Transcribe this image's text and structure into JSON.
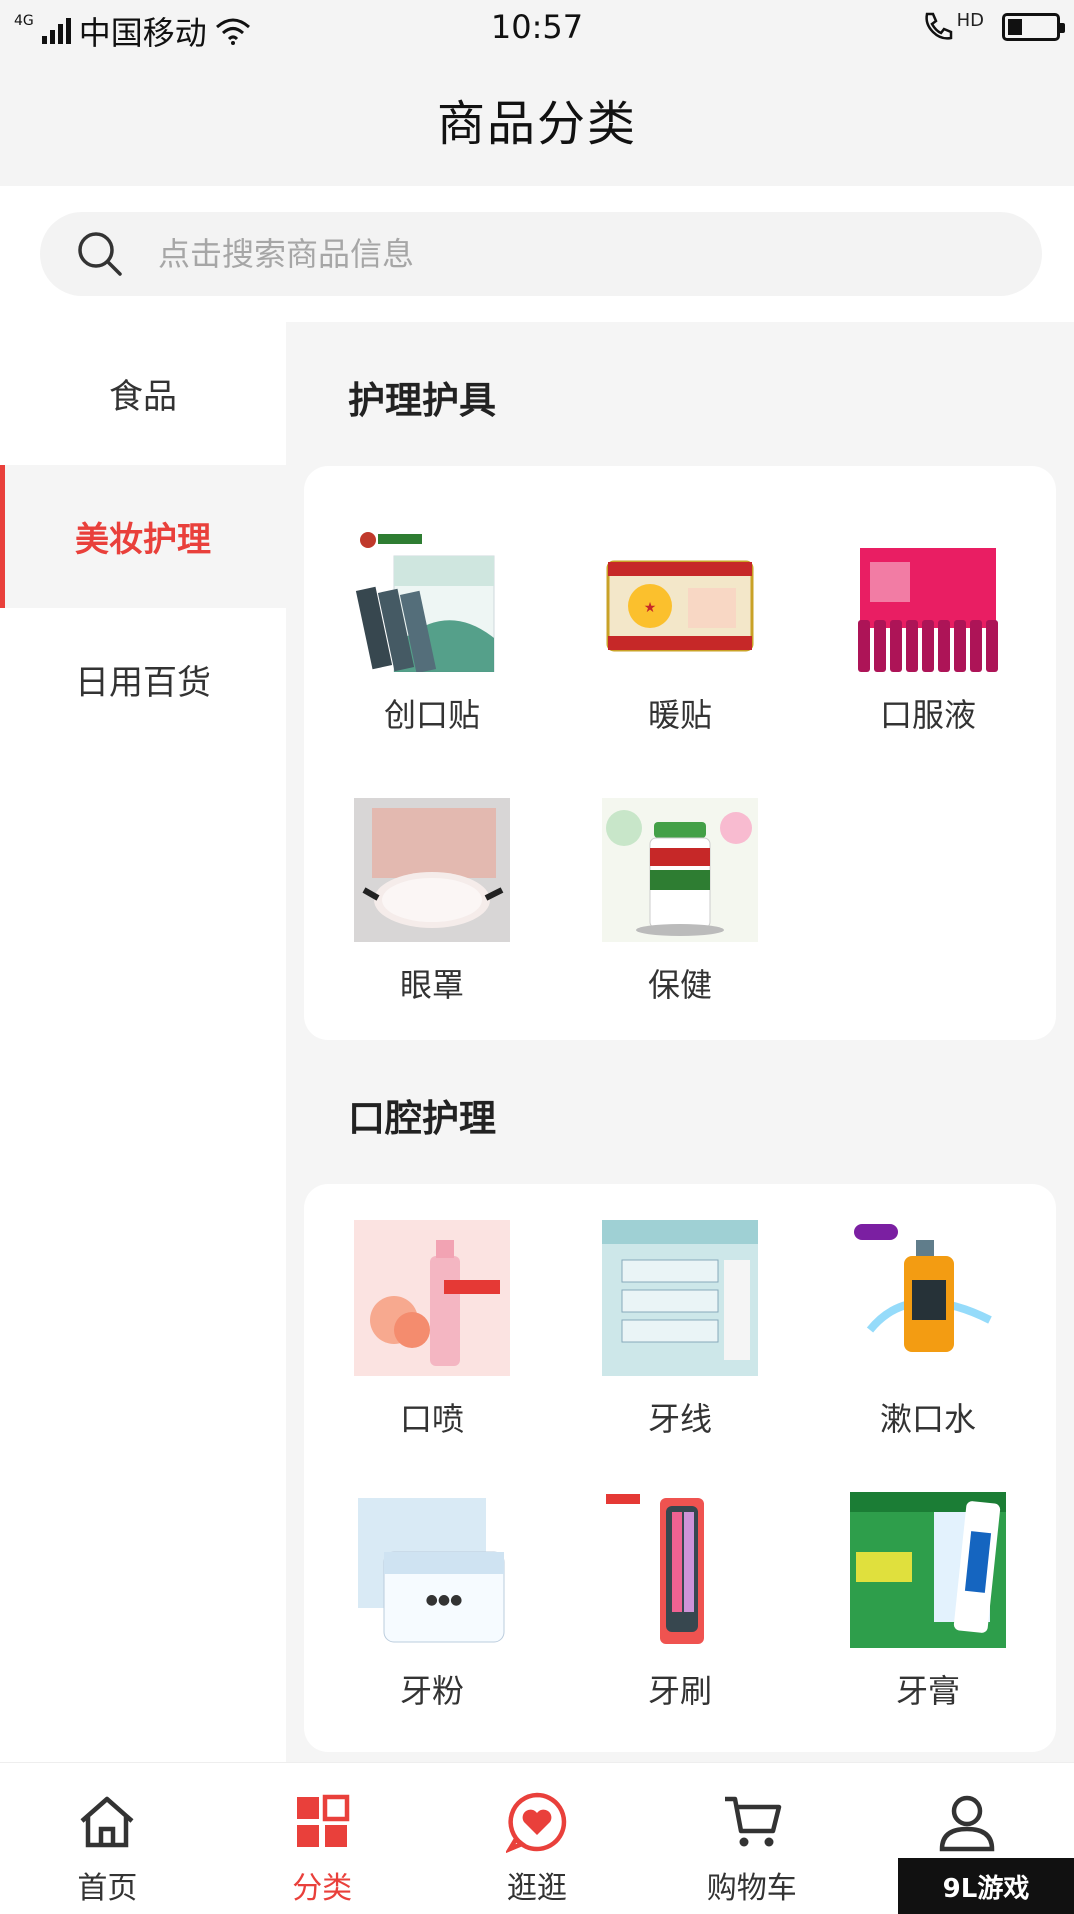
{
  "status_bar": {
    "network": "4G",
    "carrier": "中国移动",
    "time": "10:57",
    "hd": "HD",
    "battery_level": 0.3
  },
  "header": {
    "title": "商品分类"
  },
  "search": {
    "placeholder": "点击搜索商品信息",
    "value": ""
  },
  "sidebar": {
    "items": [
      {
        "label": "食品",
        "active": false
      },
      {
        "label": "美妆护理",
        "active": true
      },
      {
        "label": "日用百货",
        "active": false
      }
    ]
  },
  "sections": [
    {
      "title": "护理护具",
      "items": [
        {
          "label": "创口贴",
          "icon": "bandage-box-image"
        },
        {
          "label": "暖贴",
          "icon": "heat-patch-image"
        },
        {
          "label": "口服液",
          "icon": "oral-liquid-image"
        },
        {
          "label": "眼罩",
          "icon": "eye-mask-image"
        },
        {
          "label": "保健",
          "icon": "supplement-jar-image"
        }
      ]
    },
    {
      "title": "口腔护理",
      "items": [
        {
          "label": "口喷",
          "icon": "mouth-spray-image"
        },
        {
          "label": "牙线",
          "icon": "floss-image"
        },
        {
          "label": "漱口水",
          "icon": "mouthwash-image"
        },
        {
          "label": "牙粉",
          "icon": "tooth-powder-image"
        },
        {
          "label": "牙刷",
          "icon": "toothbrush-image"
        },
        {
          "label": "牙膏",
          "icon": "toothpaste-image"
        }
      ]
    }
  ],
  "bottom_nav": {
    "items": [
      {
        "label": "首页",
        "icon": "home-icon",
        "active": false
      },
      {
        "label": "分类",
        "icon": "category-grid-icon",
        "active": true
      },
      {
        "label": "逛逛",
        "icon": "heart-chat-icon",
        "active": false
      },
      {
        "label": "购物车",
        "icon": "cart-icon",
        "active": false
      },
      {
        "label": "",
        "icon": "user-icon",
        "active": false
      }
    ]
  },
  "colors": {
    "accent": "#e9403b",
    "background": "#f5f5f5",
    "card": "#ffffff"
  },
  "watermark": "9L游戏"
}
